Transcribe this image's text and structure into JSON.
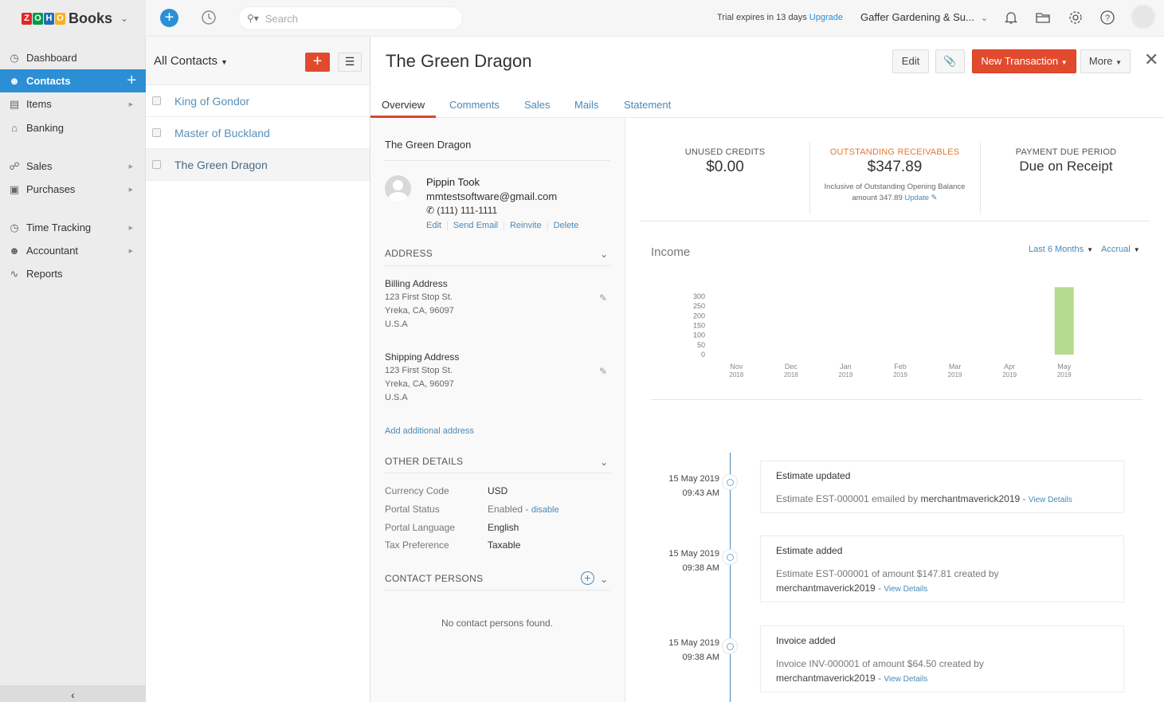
{
  "app": {
    "brand": "Books",
    "logo_letters": [
      "Z",
      "O",
      "H",
      "O"
    ],
    "logo_colors": [
      "#e42527",
      "#089949",
      "#226db4",
      "#f9b21d"
    ],
    "search_placeholder": "Search",
    "trial_text": "Trial expires in 13 days",
    "upgrade_label": "Upgrade",
    "org_name": "Gaffer Gardening & Su...",
    "icons": [
      "bell-icon",
      "folder-icon",
      "gear-icon",
      "help-icon"
    ],
    "accent": "#2c8fd6",
    "primary_button": "#e24a2e"
  },
  "sidebar": {
    "items": [
      {
        "label": "Dashboard",
        "icon": "dashboard-icon",
        "arrow": false
      },
      {
        "label": "Contacts",
        "icon": "contacts-icon",
        "active": true
      },
      {
        "label": "Items",
        "icon": "items-icon",
        "arrow": true
      },
      {
        "label": "Banking",
        "icon": "bank-icon",
        "arrow": false
      },
      {
        "label": "Sales",
        "icon": "cart-icon",
        "arrow": true
      },
      {
        "label": "Purchases",
        "icon": "bag-icon",
        "arrow": true
      },
      {
        "label": "Time Tracking",
        "icon": "timer-icon",
        "arrow": true
      },
      {
        "label": "Accountant",
        "icon": "accountant-icon",
        "arrow": true
      },
      {
        "label": "Reports",
        "icon": "reports-icon",
        "arrow": false
      }
    ],
    "collapse_glyph": "‹"
  },
  "contacts": {
    "filter_label": "All Contacts",
    "rows": [
      {
        "name": "King of Gondor",
        "selected": false
      },
      {
        "name": "Master of Buckland",
        "selected": false
      },
      {
        "name": "The Green Dragon",
        "selected": true
      }
    ]
  },
  "detail": {
    "title": "The Green Dragon",
    "buttons": {
      "edit": "Edit",
      "new_transaction": "New Transaction",
      "more": "More"
    },
    "tabs": [
      "Overview",
      "Comments",
      "Sales",
      "Mails",
      "Statement"
    ],
    "active_tab": "Overview",
    "company_name": "The Green Dragon",
    "person": {
      "name": "Pippin Took",
      "email": "mmtestsoftware@gmail.com",
      "phone": "(111) 111-1111",
      "actions": [
        "Edit",
        "Send Email",
        "Reinvite",
        "Delete"
      ]
    },
    "address_section": "ADDRESS",
    "billing": {
      "title": "Billing Address",
      "lines": [
        "123 First Stop St.",
        "Yreka, CA, 96097",
        "U.S.A"
      ]
    },
    "shipping": {
      "title": "Shipping Address",
      "lines": [
        "123 First Stop St.",
        "Yreka, CA, 96097",
        "U.S.A"
      ]
    },
    "add_address": "Add additional address",
    "other_section": "OTHER DETAILS",
    "other_details": [
      {
        "key": "Currency Code",
        "value": "USD"
      },
      {
        "key": "Portal Status",
        "value": "Enabled -",
        "link": "disable"
      },
      {
        "key": "Portal Language",
        "value": "English"
      },
      {
        "key": "Tax Preference",
        "value": "Taxable"
      }
    ],
    "contact_persons_section": "CONTACT PERSONS",
    "no_contacts": "No contact persons found."
  },
  "stats": {
    "unused_credits": {
      "label": "UNUSED CREDITS",
      "value": "$0.00"
    },
    "outstanding": {
      "label": "OUTSTANDING RECEIVABLES",
      "value": "$347.89",
      "note_line1": "Inclusive of Outstanding Opening Balance",
      "note_line2": "amount 347.89",
      "note_link": "Update"
    },
    "payment_due": {
      "label": "PAYMENT DUE PERIOD",
      "value": "Due on Receipt"
    }
  },
  "income": {
    "title": "Income",
    "period_filter": "Last 6 Months",
    "basis_filter": "Accrual"
  },
  "chart_data": {
    "type": "bar",
    "title": "Income",
    "categories": [
      "Nov 2018",
      "Dec 2018",
      "Jan 2019",
      "Feb 2019",
      "Mar 2019",
      "Apr 2019",
      "May 2019"
    ],
    "category_lines": [
      [
        "Nov",
        "2018"
      ],
      [
        "Dec",
        "2018"
      ],
      [
        "Jan",
        "2019"
      ],
      [
        "Feb",
        "2019"
      ],
      [
        "Mar",
        "2019"
      ],
      [
        "Apr",
        "2019"
      ],
      [
        "May",
        "2019"
      ]
    ],
    "values": [
      0,
      0,
      0,
      0,
      0,
      0,
      347.89
    ],
    "yticks": [
      0,
      50,
      100,
      150,
      200,
      250,
      300
    ],
    "ylim": [
      0,
      350
    ],
    "xlabel": "",
    "ylabel": "",
    "bar_color": "#b5dc8e",
    "grid": false
  },
  "timeline": [
    {
      "date": "15 May 2019",
      "time": "09:43 AM",
      "title": "Estimate updated",
      "body": "Estimate EST-000001 emailed by",
      "user": "merchantmaverick2019",
      "link": "View Details"
    },
    {
      "date": "15 May 2019",
      "time": "09:38 AM",
      "title": "Estimate added",
      "body": "Estimate EST-000001 of amount $147.81 created by",
      "user": "merchantmaverick2019",
      "link": "View Details"
    },
    {
      "date": "15 May 2019",
      "time": "09:38 AM",
      "title": "Invoice added",
      "body": "Invoice INV-000001 of amount $64.50 created by",
      "user": "merchantmaverick2019",
      "link": "View Details"
    }
  ]
}
